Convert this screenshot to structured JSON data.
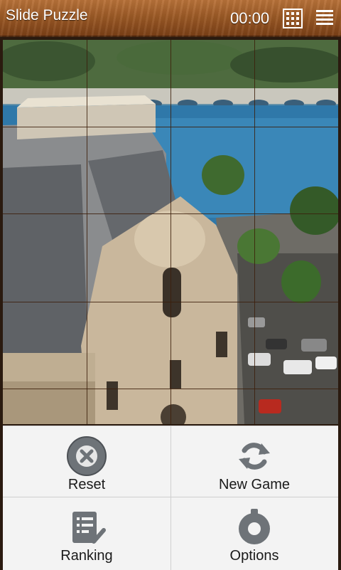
{
  "header": {
    "title": "Slide Puzzle",
    "timer": "00:00",
    "grid_icon": "grid-icon",
    "menu_icon": "menu-icon"
  },
  "puzzle": {
    "image": "photo of ornate building roof and lakeside street with parked cars",
    "grid": {
      "columns": 4,
      "rows": 5
    }
  },
  "menu": {
    "items": [
      {
        "label": "Reset",
        "icon": "close-circle-icon"
      },
      {
        "label": "New Game",
        "icon": "refresh-icon"
      },
      {
        "label": "Ranking",
        "icon": "ranking-list-icon"
      },
      {
        "label": "Options",
        "icon": "settings-power-icon"
      }
    ]
  }
}
